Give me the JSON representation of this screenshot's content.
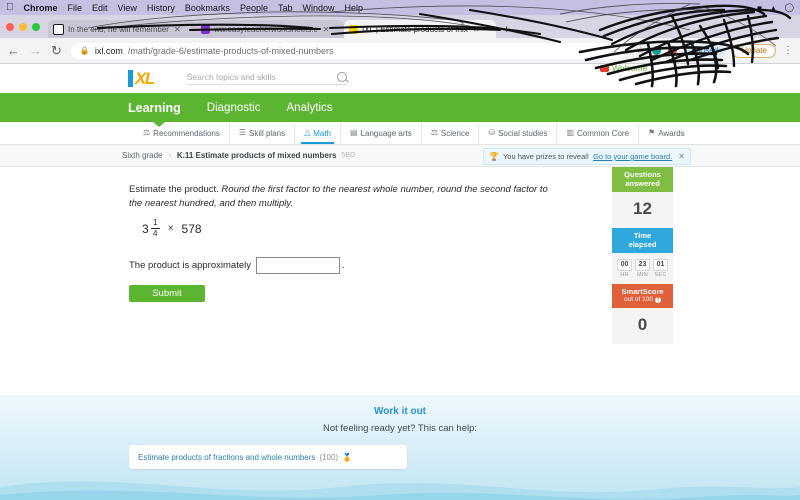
{
  "os_menu": {
    "apple_icon": "apple-icon",
    "items": [
      "Chrome",
      "File",
      "Edit",
      "View",
      "History",
      "Bookmarks",
      "People",
      "Tab",
      "Window",
      "Help"
    ]
  },
  "browser": {
    "tabs": [
      {
        "title": "In the end, he will remember",
        "favicon": "document-favicon",
        "active": false
      },
      {
        "title": "ww.easyteacherworksheets.c",
        "favicon": "purple-favicon",
        "active": false
      },
      {
        "title": "IXL | Estimate products of mix",
        "favicon": "ixl-favicon",
        "active": true
      }
    ],
    "new_tab_label": "+",
    "close_label": "✕",
    "back_icon": "back-arrow-icon",
    "forward_icon": "forward-arrow-icon",
    "reload_icon": "reload-icon",
    "lock_icon": "lock-icon",
    "url_domain": "ixl.com",
    "url_path": "/math/grade-6/estimate-products-of-mixed-numbers",
    "star_icon": "bookmark-star-icon",
    "paused_label": "Paused",
    "update_label": "Update",
    "menu_icon": "kebab-menu-icon"
  },
  "site": {
    "logo_text": "XL",
    "search_placeholder": "Search topics and skills",
    "search_icon": "search-icon",
    "welcome_text": "Welcome",
    "nav": [
      {
        "label": "Learning",
        "active": true
      },
      {
        "label": "Diagnostic",
        "active": false
      },
      {
        "label": "Analytics",
        "active": false
      }
    ],
    "subnav": [
      {
        "label": "Recommendations",
        "icon": "⚗",
        "active": false
      },
      {
        "label": "Skill plans",
        "icon": "☰",
        "active": false
      },
      {
        "label": "Math",
        "icon": "△",
        "active": true
      },
      {
        "label": "Language arts",
        "icon": "▤",
        "active": false
      },
      {
        "label": "Science",
        "icon": "⚖",
        "active": false
      },
      {
        "label": "Social studies",
        "icon": "♁",
        "active": false
      },
      {
        "label": "Common Core",
        "icon": "▥",
        "active": false
      },
      {
        "label": "Awards",
        "icon": "⚑",
        "active": false
      }
    ]
  },
  "breadcrumb": {
    "grade": "Sixth grade",
    "separator": "›",
    "skill": "K.11 Estimate products of mixed numbers",
    "code": "5BG"
  },
  "prize_banner": {
    "trophy_icon": "trophy-icon",
    "text": "You have prizes to reveal!",
    "link": "Go to your game board.",
    "close_icon": "✕"
  },
  "question": {
    "prompt_plain": "Estimate the product.",
    "prompt_italic": "Round the first factor to the nearest whole number, round the second factor to the nearest hundred, and then multiply.",
    "whole": "3",
    "numerator": "1",
    "denominator": "4",
    "operator": "×",
    "second_factor": "578",
    "answer_label": "The product is approximately",
    "answer_value": "",
    "period": ".",
    "submit_label": "Submit"
  },
  "stats": {
    "questions_header_line1": "Questions",
    "questions_header_line2": "answered",
    "questions_value": "12",
    "time_header_line1": "Time",
    "time_header_line2": "elapsed",
    "hours": "00",
    "minutes": "23",
    "seconds": "01",
    "hours_label": "HR",
    "minutes_label": "MIN",
    "seconds_label": "SEC",
    "score_header": "SmartScore",
    "score_sub": "out of 100",
    "score_info_icon": "?",
    "score_value": "0"
  },
  "help": {
    "work_it_out": "Work it out",
    "not_ready": "Not feeling ready yet? This can help:",
    "card_link": "Estimate products of fractions and whole numbers",
    "card_count": "(100)",
    "card_icon": "medal-icon"
  },
  "colors": {
    "ixl_green": "#5cb531",
    "ixl_blue": "#1a9ad6",
    "ixl_orange": "#f5a800",
    "smartscore_orange": "#e0603a",
    "time_blue": "#2fa8dd",
    "questions_green": "#7fbe42"
  }
}
